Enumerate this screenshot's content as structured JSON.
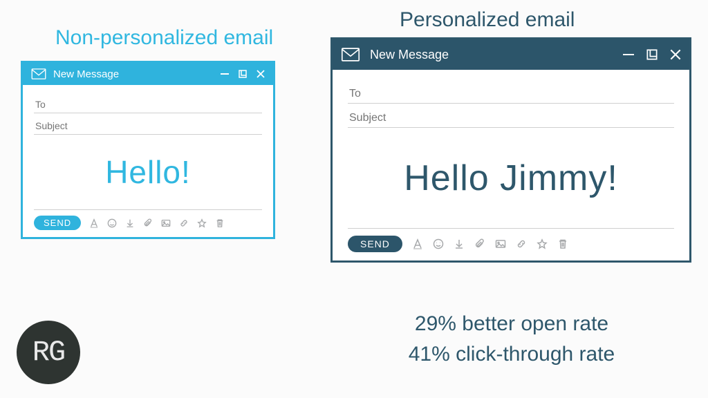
{
  "headings": {
    "nonpersonalized": "Non-personalized email",
    "personalized": "Personalized email"
  },
  "compose_left": {
    "title": "New Message",
    "to_placeholder": "To",
    "subject_placeholder": "Subject",
    "body_text": "Hello!",
    "send_label": "SEND"
  },
  "compose_right": {
    "title": "New Message",
    "to_placeholder": "To",
    "subject_placeholder": "Subject",
    "body_text": "Hello Jimmy!",
    "send_label": "SEND"
  },
  "stats": {
    "line1": "29% better open rate",
    "line2": "41% click-through rate"
  },
  "logo": {
    "text": "RG"
  },
  "colors": {
    "nonpersonalized_accent": "#30B7E0",
    "personalized_accent": "#2E576B"
  }
}
